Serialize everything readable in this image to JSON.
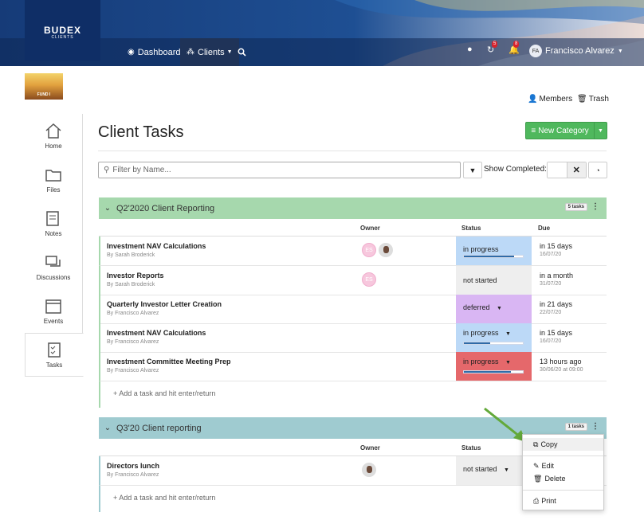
{
  "brand": {
    "name": "BUDEX",
    "sub": "CLIENTS"
  },
  "nav": {
    "dashboard": "Dashboard",
    "clients": "Clients"
  },
  "notifications": {
    "messages_badge": "5",
    "alerts_badge": "8"
  },
  "user": {
    "initials": "FA",
    "name": "Francisco Alvarez"
  },
  "fund_label": "FUND I",
  "toplinks": {
    "members": "Members",
    "trash": "Trash"
  },
  "sidebar": {
    "items": [
      {
        "label": "Home",
        "icon": "home-icon"
      },
      {
        "label": "Files",
        "icon": "files-icon"
      },
      {
        "label": "Notes",
        "icon": "notes-icon"
      },
      {
        "label": "Discussions",
        "icon": "discussions-icon"
      },
      {
        "label": "Events",
        "icon": "calendar-icon"
      },
      {
        "label": "Tasks",
        "icon": "tasks-icon"
      }
    ]
  },
  "page": {
    "title": "Client Tasks",
    "new_category": "New Category",
    "filter_placeholder": "Filter by Name...",
    "show_completed": "Show Completed:"
  },
  "columns": {
    "owner": "Owner",
    "status": "Status",
    "due": "Due"
  },
  "categories": [
    {
      "name": "Q2'2020 Client Reporting",
      "count": "5 tasks",
      "color": "#a6d8ad",
      "tasks": [
        {
          "title": "Investment NAV Calculations",
          "by": "By Sarah Broderick",
          "status": "in progress",
          "progress": 0.85,
          "due": "in 15 days",
          "date": "16/07/20"
        },
        {
          "title": "Investor Reports",
          "by": "By Sarah Broderick",
          "status": "not started",
          "due": "in a month",
          "date": "31/07/20"
        },
        {
          "title": "Quarterly Investor Letter Creation",
          "by": "By Francisco Alvarez",
          "status": "deferred",
          "due": "in 21 days",
          "date": "22/07/20"
        },
        {
          "title": "Investment NAV Calculations",
          "by": "By Francisco Alvarez",
          "status": "in progress",
          "progress": 0.45,
          "due": "in 15 days",
          "date": "16/07/20"
        },
        {
          "title": "Investment Committee Meeting Prep",
          "by": "By Francisco Alvarez",
          "status": "in progress",
          "progress": 0.8,
          "due": "13 hours ago",
          "date": "30/06/20 at 09:00"
        }
      ],
      "add": "+ Add a task and hit enter/return"
    },
    {
      "name": "Q3'20 Client reporting",
      "count": "1 tasks",
      "color": "#9fcbd0",
      "tasks": [
        {
          "title": "Directors lunch",
          "by": "By Francisco Alvarez",
          "status": "not started"
        }
      ],
      "add": "+ Add a task and hit enter/return"
    }
  ],
  "owners": {
    "es": "ES"
  },
  "context_menu": {
    "copy": "Copy",
    "edit": "Edit",
    "delete": "Delete",
    "print": "Print"
  }
}
